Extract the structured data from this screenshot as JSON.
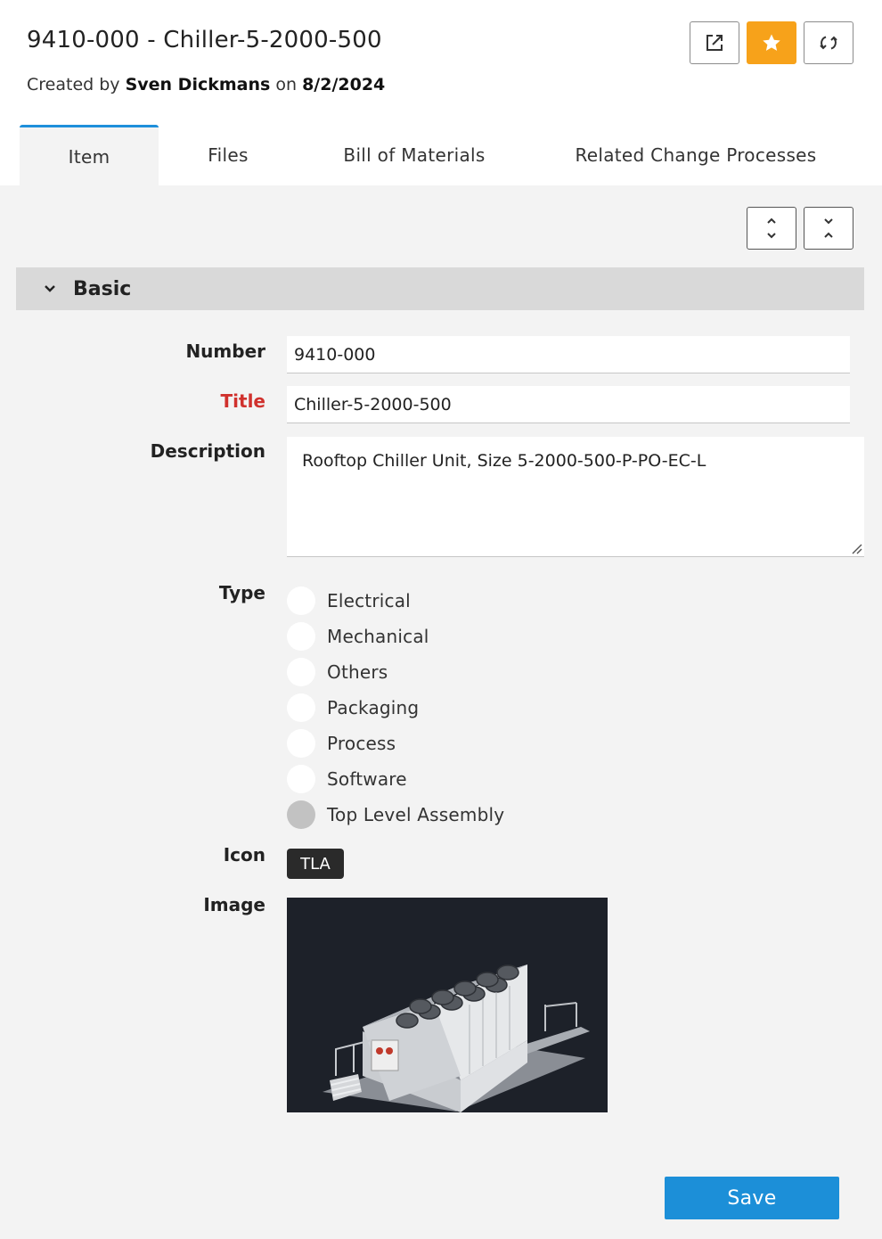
{
  "header": {
    "title": "9410-000 - Chiller-5-2000-500",
    "created_prefix": "Created by ",
    "created_by": "Sven Dickmans",
    "created_on_prefix": " on ",
    "created_date": "8/2/2024",
    "buttons": [
      {
        "name": "open-in-new-window",
        "icon": "external-link-icon"
      },
      {
        "name": "favorite",
        "icon": "star-icon",
        "active": true,
        "color": "#f7a21a"
      },
      {
        "name": "refresh",
        "icon": "refresh-icon"
      }
    ]
  },
  "tabs": [
    {
      "label": "Item",
      "active": true
    },
    {
      "label": "Files",
      "active": false
    },
    {
      "label": "Bill of Materials",
      "active": false
    },
    {
      "label": "Related Change Processes",
      "active": false
    }
  ],
  "toolbar": {
    "expand_all_icon": "expand-all-icon",
    "collapse_all_icon": "collapse-all-icon"
  },
  "section": {
    "title": "Basic",
    "expanded": true
  },
  "fields": {
    "number": {
      "label": "Number",
      "value": "9410-000"
    },
    "title": {
      "label": "Title",
      "value": "Chiller-5-2000-500",
      "required": true,
      "label_color": "#d0312d"
    },
    "description": {
      "label": "Description",
      "value": "Rooftop Chiller Unit, Size 5-2000-500-P-PO-EC-L"
    },
    "type": {
      "label": "Type",
      "options": [
        "Electrical",
        "Mechanical",
        "Others",
        "Packaging",
        "Process",
        "Software",
        "Top Level Assembly"
      ],
      "selected": "Top Level Assembly"
    },
    "icon": {
      "label": "Icon",
      "value": "TLA"
    },
    "image": {
      "label": "Image"
    }
  },
  "actions": {
    "save_label": "Save",
    "save_color": "#1c8fd8"
  },
  "colors": {
    "tab_accent": "#1e8fdb",
    "content_bg": "#f3f3f3",
    "section_bg": "#d9d9d9"
  }
}
